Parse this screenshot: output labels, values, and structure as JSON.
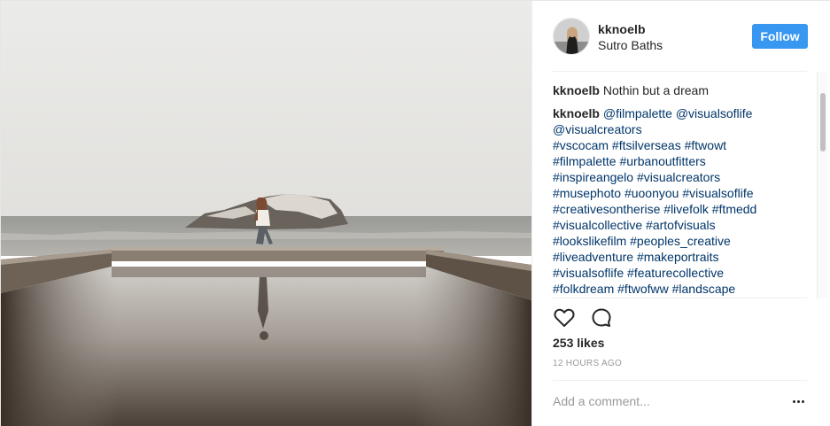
{
  "post": {
    "author": {
      "username": "kknoelb",
      "location": "Sutro Baths"
    },
    "follow_label": "Follow",
    "caption": {
      "username": "kknoelb",
      "text": "Nothin but a dream"
    },
    "tags_comment": {
      "username": "kknoelb",
      "lines": [
        "@filmpalette @visualsoflife",
        "@visualcreators",
        "#vscocam #ftsilverseas #ftwowt",
        "#filmpalette #urbanoutfitters",
        "#inspireangelo #visualcreators",
        "#musephoto #uoonyou #visualsoflife",
        "#creativesontherise #livefolk #ftmedd",
        "#visualcollective #artofvisuals",
        "#lookslikefilm #peoples_creative",
        "#liveadventure #makeportraits",
        "#visualsoflife #featurecollective",
        "#folkdream #ftwofww #landscape"
      ]
    },
    "likes": "253 likes",
    "timestamp": "12 HOURS AGO",
    "add_comment_placeholder": "Add a comment...",
    "icons": {
      "like": "heart-icon",
      "comment": "speech-bubble-icon",
      "more": "ellipsis-icon"
    },
    "colors": {
      "follow_button": "#3897f0",
      "hashtag": "#003569",
      "meta": "#999999"
    }
  }
}
